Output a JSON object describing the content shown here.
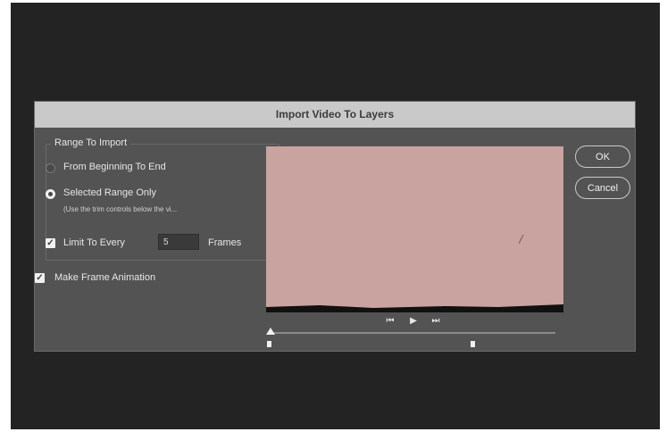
{
  "dialog": {
    "title": "Import Video To Layers",
    "range_group_title": "Range To Import",
    "option_beginning": "From Beginning To End",
    "option_selected": "Selected Range Only",
    "option_selected_hint": "(Use the trim controls below the vi...",
    "selected_option": "Selected Range Only",
    "limit_label": "Limit To Every",
    "limit_checked": true,
    "limit_value": "5",
    "limit_unit": "Frames",
    "frame_animation_label": "Make Frame Animation",
    "frame_animation_checked": true,
    "ok_label": "OK",
    "cancel_label": "Cancel"
  },
  "playback": {
    "icons": [
      "step-back-icon",
      "play-icon",
      "step-forward-icon"
    ]
  },
  "colors": {
    "background": "#232323",
    "dialog": "#535353",
    "titlebar": "#c9c9c9",
    "preview": "#c8a39f"
  }
}
